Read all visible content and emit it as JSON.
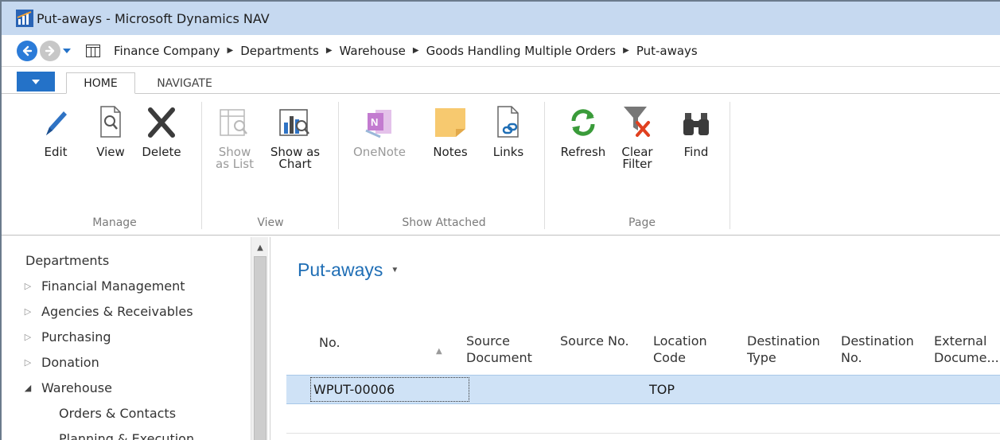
{
  "window": {
    "title": "Put-aways - Microsoft Dynamics NAV"
  },
  "breadcrumb": [
    "Finance Company",
    "Departments",
    "Warehouse",
    "Goods Handling Multiple Orders",
    "Put-aways"
  ],
  "tabs": {
    "home": "HOME",
    "navigate": "NAVIGATE"
  },
  "ribbon": {
    "manage": {
      "edit": "Edit",
      "view": "View",
      "delete": "Delete",
      "group": "Manage"
    },
    "view": {
      "show_as_list_1": "Show",
      "show_as_list_2": "as List",
      "show_as_chart_1": "Show as",
      "show_as_chart_2": "Chart",
      "group": "View"
    },
    "attached": {
      "onenote": "OneNote",
      "notes": "Notes",
      "links": "Links",
      "group": "Show Attached"
    },
    "page": {
      "refresh": "Refresh",
      "clear_filter_1": "Clear",
      "clear_filter_2": "Filter",
      "find": "Find",
      "group": "Page"
    }
  },
  "sidebar": {
    "root": "Departments",
    "items": [
      "Financial Management",
      "Agencies & Receivables",
      "Purchasing",
      "Donation",
      "Warehouse"
    ],
    "warehouse_children": [
      "Orders & Contacts",
      "Planning & Execution"
    ]
  },
  "page": {
    "title": "Put-aways"
  },
  "grid": {
    "headers": {
      "no": "No.",
      "source_document_1": "Source",
      "source_document_2": "Document",
      "source_no": "Source No.",
      "location_code_1": "Location",
      "location_code_2": "Code",
      "destination_type_1": "Destination",
      "destination_type_2": "Type",
      "destination_no_1": "Destination",
      "destination_no_2": "No.",
      "external_document_1": "External",
      "external_document_2": "Docume..."
    },
    "rows": [
      {
        "no": "WPUT-00006",
        "location_code": "TOP"
      }
    ]
  },
  "colors": {
    "accent": "#2472c8",
    "title_blue": "#1f6eb5",
    "selection": "#cfe2f6",
    "titlebar": "#c6d9f0"
  }
}
